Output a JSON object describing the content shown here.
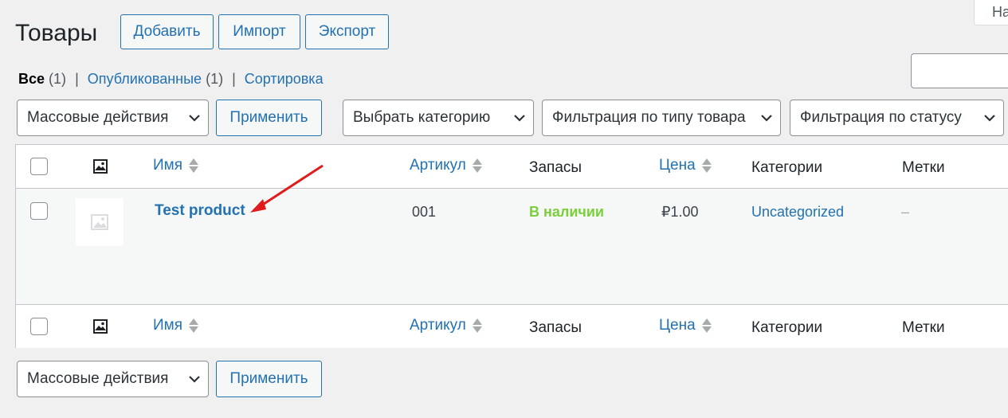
{
  "page": {
    "title": "Товары",
    "actions": [
      "Добавить",
      "Импорт",
      "Экспорт"
    ],
    "help_tab_label": "На"
  },
  "views": {
    "all_label": "Все",
    "all_count": "(1)",
    "published_label": "Опубликованные",
    "published_count": "(1)",
    "sorting_label": "Сортировка",
    "separator": "|"
  },
  "filters": {
    "bulk_actions": "Массовые действия",
    "apply": "Применить",
    "category": "Выбрать категорию",
    "product_type": "Фильтрация по типу товара",
    "stock_status": "Фильтрация по статусу"
  },
  "table": {
    "columns": {
      "image_icon": "image-icon",
      "name": "Имя",
      "sku": "Артикул",
      "stock": "Запасы",
      "price": "Цена",
      "categories": "Категории",
      "tags": "Метки"
    },
    "rows": [
      {
        "name": "Test product",
        "sku": "001",
        "stock": "В наличии",
        "price": "₽1.00",
        "categories": "Uncategorized",
        "tags": "–"
      }
    ]
  },
  "bottom_bar": {
    "bulk_actions": "Массовые действия",
    "apply": "Применить"
  },
  "colors": {
    "link": "#2271b1",
    "in_stock": "#7ad03a",
    "annotation_arrow": "#e01b1b"
  }
}
